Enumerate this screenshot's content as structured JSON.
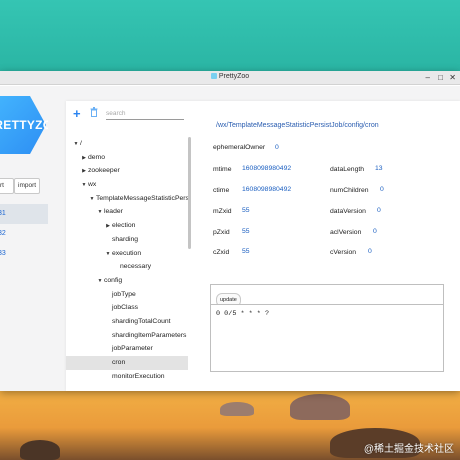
{
  "window": {
    "title": "PrettyZoo"
  },
  "sidebar": {
    "logo_text": "PRETTYZOO",
    "buttons": [
      {
        "label": "rt"
      },
      {
        "label": "import"
      }
    ],
    "servers": [
      {
        "label": "31",
        "selected": true
      },
      {
        "label": "32",
        "selected": false
      },
      {
        "label": "33",
        "selected": false
      }
    ]
  },
  "toolbar": {
    "add_label": "+",
    "search_placeholder": "search"
  },
  "tree": [
    {
      "label": "/",
      "arrow": "▼",
      "indent": 0
    },
    {
      "label": "demo",
      "arrow": "▶",
      "indent": 1
    },
    {
      "label": "zookeeper",
      "arrow": "▶",
      "indent": 1
    },
    {
      "label": "wx",
      "arrow": "▼",
      "indent": 1
    },
    {
      "label": "TemplateMessageStatisticPersi",
      "arrow": "▼",
      "indent": 2
    },
    {
      "label": "leader",
      "arrow": "▼",
      "indent": 3
    },
    {
      "label": "election",
      "arrow": "▶",
      "indent": 4
    },
    {
      "label": "sharding",
      "arrow": "",
      "indent": 4
    },
    {
      "label": "execution",
      "arrow": "▼",
      "indent": 4
    },
    {
      "label": "necessary",
      "arrow": "",
      "indent": 5
    },
    {
      "label": "config",
      "arrow": "▼",
      "indent": 3
    },
    {
      "label": "jobType",
      "arrow": "",
      "indent": 4
    },
    {
      "label": "jobClass",
      "arrow": "",
      "indent": 4
    },
    {
      "label": "shardingTotalCount",
      "arrow": "",
      "indent": 4
    },
    {
      "label": "shardingItemParameters",
      "arrow": "",
      "indent": 4
    },
    {
      "label": "jobParameter",
      "arrow": "",
      "indent": 4
    },
    {
      "label": "cron",
      "arrow": "",
      "indent": 4,
      "selected": true
    },
    {
      "label": "monitorExecution",
      "arrow": "",
      "indent": 4
    }
  ],
  "detail": {
    "path": "/wx/TemplateMessageStatisticPersistJob/config/cron",
    "stats": {
      "ephemeralOwner": {
        "label": "ephemeralOwner",
        "value": "0"
      },
      "mtime": {
        "label": "mtime",
        "value": "1608098980492"
      },
      "ctime": {
        "label": "ctime",
        "value": "1608098980492"
      },
      "mZxid": {
        "label": "mZxid",
        "value": "55"
      },
      "pZxid": {
        "label": "pZxid",
        "value": "55"
      },
      "cZxid": {
        "label": "cZxid",
        "value": "55"
      },
      "dataLength": {
        "label": "dataLength",
        "value": "13"
      },
      "numChildren": {
        "label": "numChildren",
        "value": "0"
      },
      "dataVersion": {
        "label": "dataVersion",
        "value": "0"
      },
      "aclVersion": {
        "label": "aclVersion",
        "value": "0"
      },
      "cVersion": {
        "label": "cVersion",
        "value": "0"
      }
    },
    "update_label": "update",
    "data_value": "0 0/5 * * * ?"
  },
  "watermark": "@稀土掘金技术社区"
}
